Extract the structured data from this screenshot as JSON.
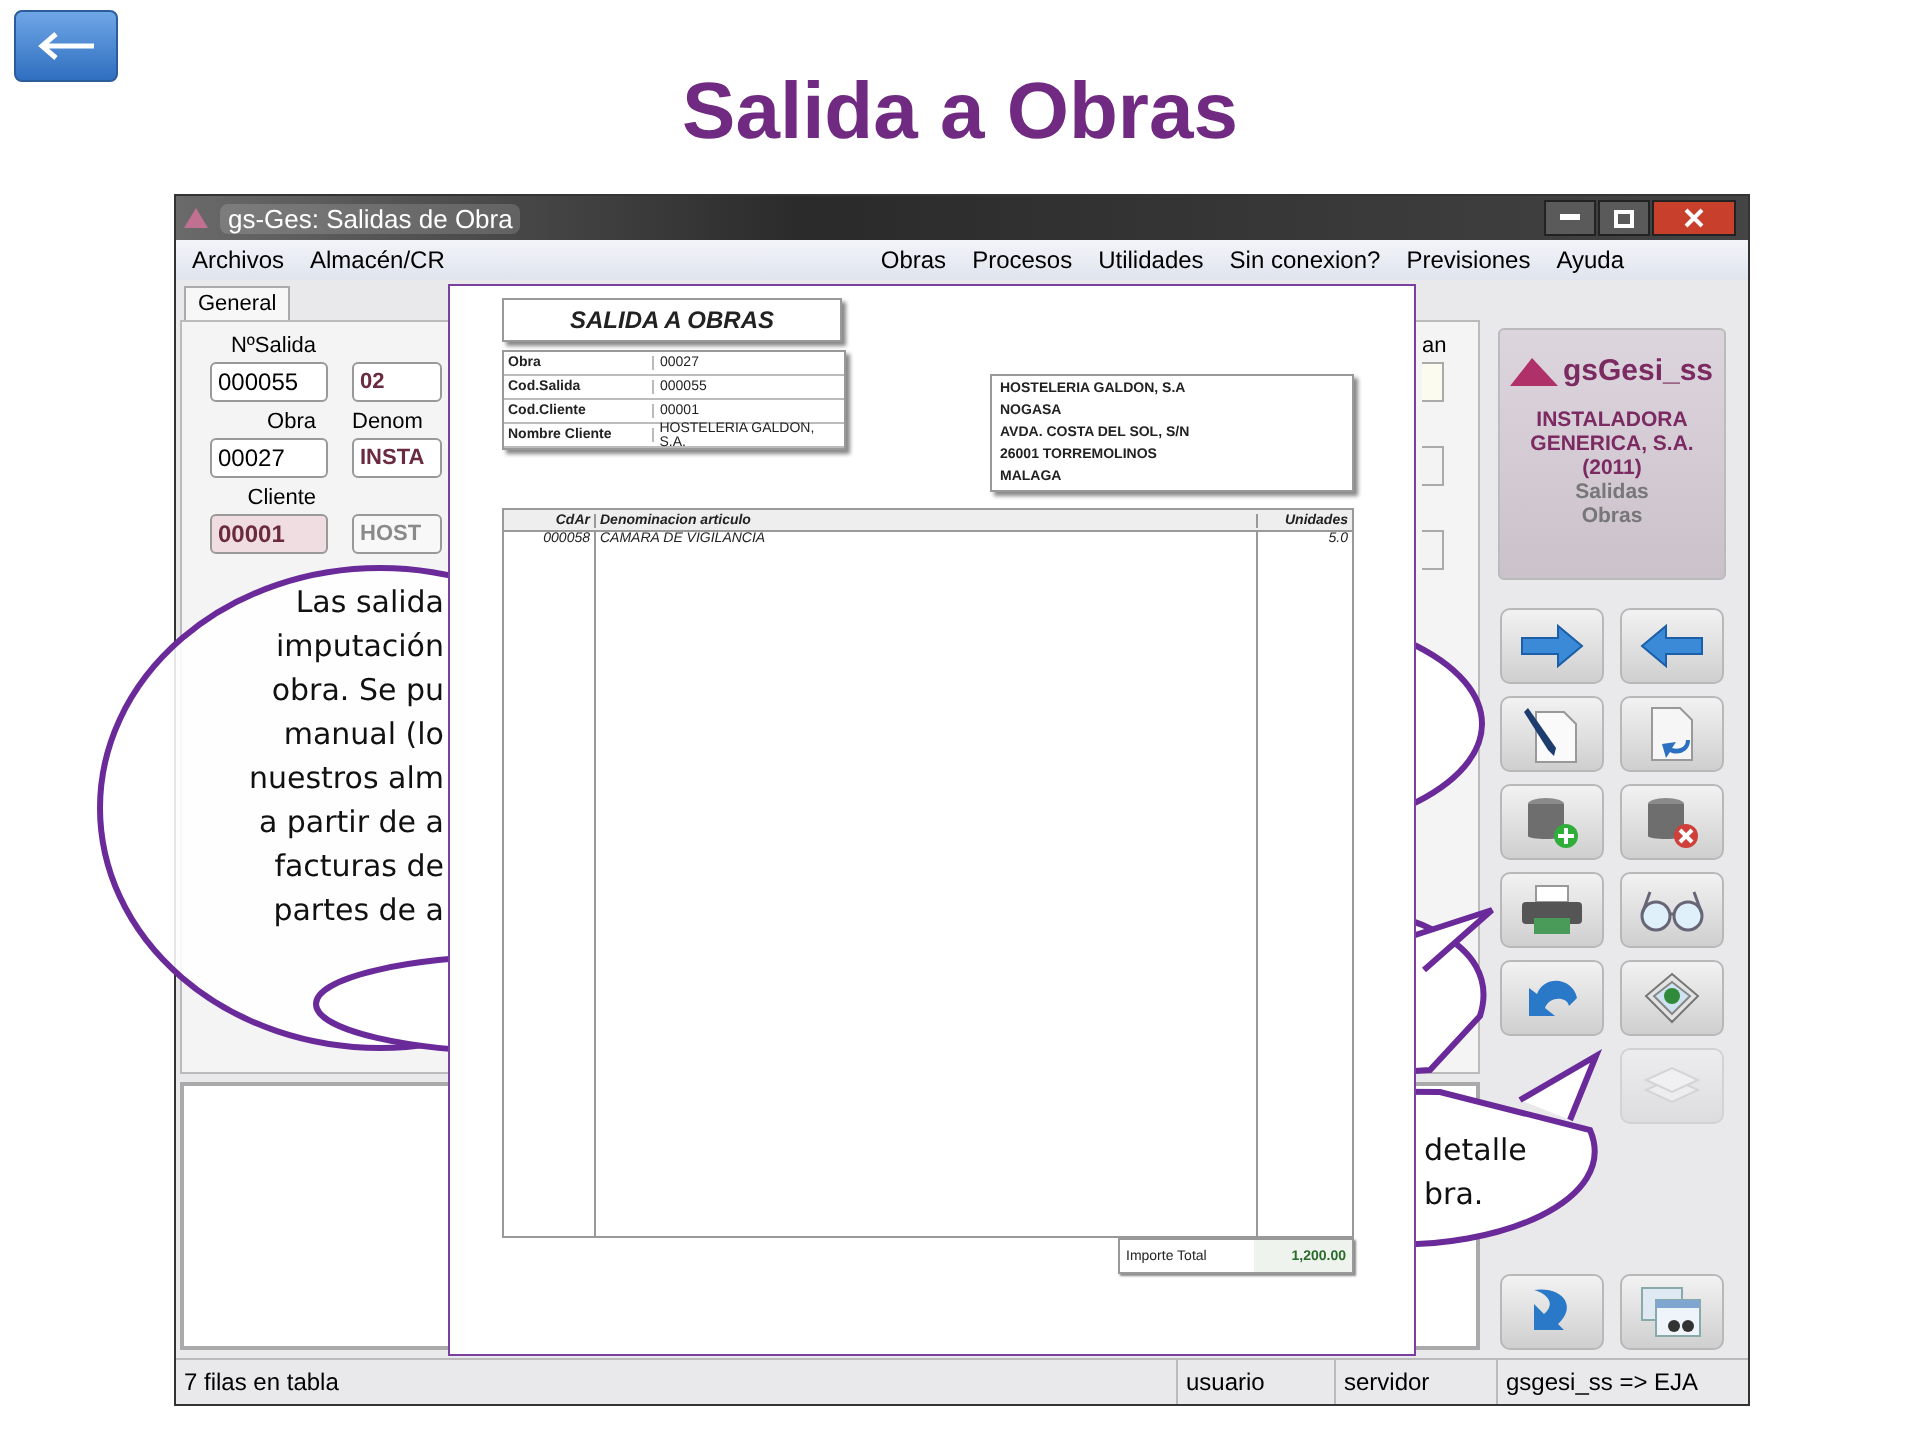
{
  "slide_title": "Salida a Obras",
  "window": {
    "title": "gs-Ges: Salidas de Obra",
    "menu_left": [
      "Archivos",
      "Almacén/CR"
    ],
    "menu_right": [
      "Obras",
      "Procesos",
      "Utilidades",
      "Sin conexion?",
      "Previsiones",
      "Ayuda"
    ],
    "tabs": [
      {
        "label": "General",
        "selected": true
      }
    ],
    "form_left": [
      {
        "label": "NºSalida",
        "value": "000055",
        "highlighted": false,
        "disabled": false
      },
      {
        "label": "Obra",
        "value": "00027",
        "highlighted": false,
        "disabled": false
      },
      {
        "label": "Cliente",
        "value": "00001",
        "highlighted": true,
        "disabled": false
      }
    ],
    "form_right": [
      {
        "value": "02",
        "disabled": false
      },
      {
        "label": "Denom",
        "value": "INSTA",
        "disabled": false
      },
      {
        "value": "HOST",
        "disabled": true
      }
    ],
    "side_label": "an",
    "status_bar": [
      "7 filas en tabla",
      "usuario",
      "servidor",
      "gsgesi_ss => EJA"
    ]
  },
  "logo": {
    "name": "gsGesi_ss",
    "company": [
      "INSTALADORA",
      "GENERICA, S.A.",
      "(2011)"
    ],
    "module": [
      "Salidas",
      "Obras"
    ]
  },
  "toolbar_buttons": [
    {
      "kind": "arrow-right",
      "disabled": false
    },
    {
      "kind": "arrow-left",
      "disabled": false
    },
    {
      "kind": "pen-document",
      "disabled": false
    },
    {
      "kind": "document-undo",
      "disabled": false
    },
    {
      "kind": "database-add",
      "disabled": false
    },
    {
      "kind": "database-delete",
      "disabled": false
    },
    {
      "kind": "printer",
      "disabled": false
    },
    {
      "kind": "glasses",
      "disabled": false
    },
    {
      "kind": "undo",
      "disabled": false
    },
    {
      "kind": "map-layers",
      "disabled": false
    },
    {
      "kind": "pages",
      "disabled": true
    }
  ],
  "bottom_buttons": [
    {
      "kind": "return",
      "disabled": false
    },
    {
      "kind": "windows-binoculars",
      "disabled": false
    }
  ],
  "document": {
    "title": "SALIDA A OBRAS",
    "info": [
      {
        "label": "Obra",
        "value": "00027"
      },
      {
        "label": "Cod.Salida",
        "value": "000055"
      },
      {
        "label": "Cod.Cliente",
        "value": "00001"
      },
      {
        "label": "Nombre Cliente",
        "value": "HOSTELERIA GALDON, S.A."
      }
    ],
    "address": [
      "HOSTELERIA GALDON, S.A",
      "NOGASA",
      "AVDA. COSTA DEL SOL, S/N",
      "26001 TORREMOLINOS",
      "MALAGA"
    ],
    "columns": [
      "CdAr",
      "Denominacion articulo",
      "Unidades"
    ],
    "rows": [
      [
        "000058",
        "CAMARA DE VIGILANCIA",
        "5.0"
      ]
    ],
    "total_label": "Importe Total",
    "total_value": "1,200.00"
  },
  "callouts": [
    {
      "lines": [
        "Las salida",
        "imputación",
        "obra. Se pu",
        "manual (lo",
        "nuestros alm",
        "a partir de a",
        "facturas de",
        "partes de a"
      ]
    },
    {
      "lines": [
        "detalle",
        "bra."
      ]
    }
  ]
}
